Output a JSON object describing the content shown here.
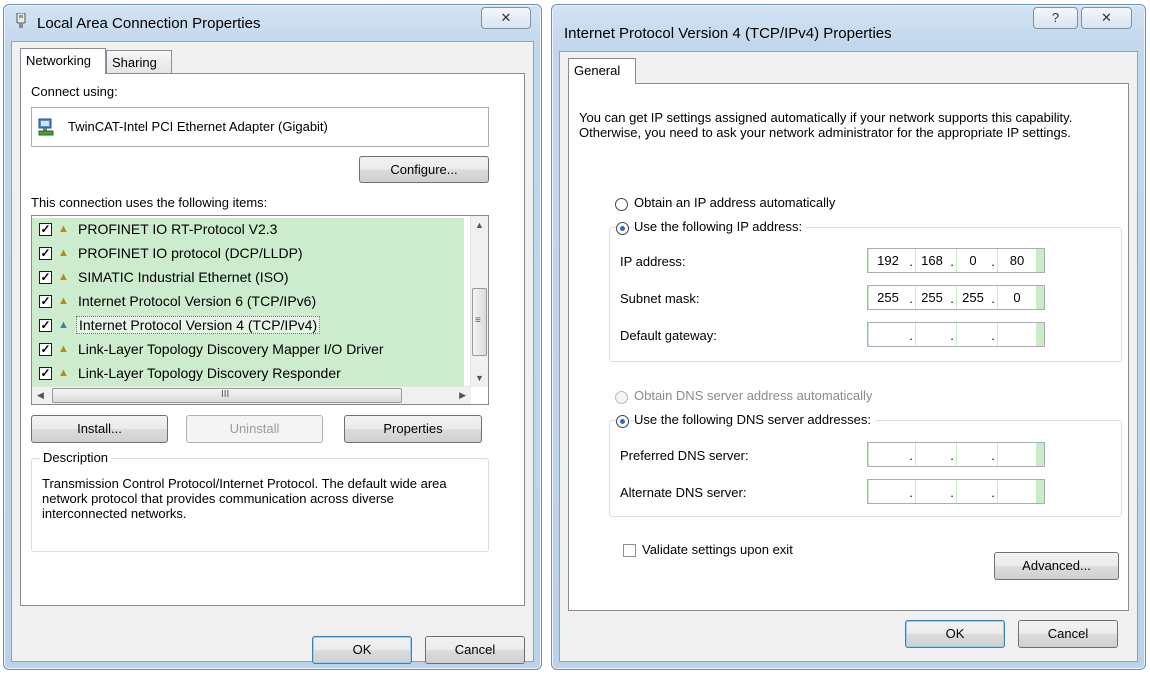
{
  "win1": {
    "title": "Local Area Connection Properties",
    "close_glyph": "✕",
    "tabs": [
      {
        "label": "Networking"
      },
      {
        "label": "Sharing"
      }
    ],
    "connect_using_label": "Connect using:",
    "adapter_name": "TwinCAT-Intel PCI Ethernet Adapter (Gigabit)",
    "configure_label": "Configure...",
    "items_label": "This connection uses the following items:",
    "items": [
      {
        "label": "PROFINET IO RT-Protocol V2.3",
        "checked": true
      },
      {
        "label": "PROFINET IO protocol (DCP/LLDP)",
        "checked": true
      },
      {
        "label": "SIMATIC Industrial Ethernet (ISO)",
        "checked": true
      },
      {
        "label": "Internet Protocol Version 6 (TCP/IPv6)",
        "checked": true
      },
      {
        "label": "Internet Protocol Version 4 (TCP/IPv4)",
        "checked": true,
        "selected": true
      },
      {
        "label": "Link-Layer Topology Discovery Mapper I/O Driver",
        "checked": true
      },
      {
        "label": "Link-Layer Topology Discovery Responder",
        "checked": true
      }
    ],
    "hscroll_glyph": "III",
    "install_label": "Install...",
    "uninstall_label": "Uninstall",
    "properties_label": "Properties",
    "description_title": "Description",
    "description_text": "Transmission Control Protocol/Internet Protocol. The default wide area network protocol that provides communication across diverse interconnected networks.",
    "ok_label": "OK",
    "cancel_label": "Cancel",
    "colors": {
      "highlight_green": "#cdeccd"
    }
  },
  "win2": {
    "title": "Internet Protocol Version 4 (TCP/IPv4) Properties",
    "help_glyph": "?",
    "close_glyph": "✕",
    "tab_general": "General",
    "intro_text": "You can get IP settings assigned automatically if your network supports this capability. Otherwise, you need to ask your network administrator for the appropriate IP settings.",
    "obtain_ip_auto": "Obtain an IP address automatically",
    "use_following_ip": "Use the following IP address:",
    "ip_address_label": "IP address:",
    "ip_address": [
      "192",
      "168",
      "0",
      "80"
    ],
    "subnet_label": "Subnet mask:",
    "subnet": [
      "255",
      "255",
      "255",
      "0"
    ],
    "gateway_label": "Default gateway:",
    "gateway": [
      "",
      "",
      "",
      ""
    ],
    "obtain_dns_auto": "Obtain DNS server address automatically",
    "use_following_dns": "Use the following DNS server addresses:",
    "preferred_dns_label": "Preferred DNS server:",
    "preferred_dns": [
      "",
      "",
      "",
      ""
    ],
    "alternate_dns_label": "Alternate DNS server:",
    "alternate_dns": [
      "",
      "",
      "",
      ""
    ],
    "validate_label": "Validate settings upon exit",
    "validate_checked": false,
    "advanced_label": "Advanced...",
    "ok_label": "OK",
    "cancel_label": "Cancel"
  }
}
